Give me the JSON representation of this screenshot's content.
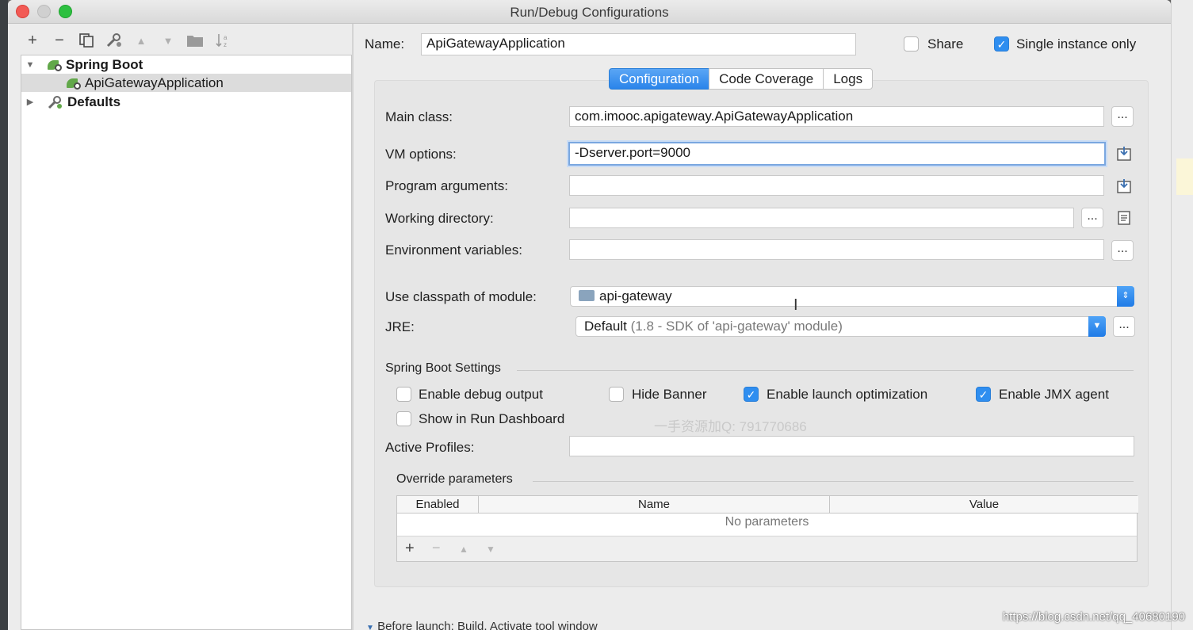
{
  "window": {
    "title": "Run/Debug Configurations"
  },
  "tree": {
    "group_label": "Spring Boot",
    "selected_item": "ApiGatewayApplication",
    "defaults_label": "Defaults"
  },
  "header": {
    "name_label": "Name:",
    "name_value": "ApiGatewayApplication",
    "share_label": "Share",
    "share_checked": false,
    "single_instance_label": "Single instance only",
    "single_instance_checked": true
  },
  "tabs": [
    {
      "label": "Configuration",
      "active": true
    },
    {
      "label": "Code Coverage",
      "active": false
    },
    {
      "label": "Logs",
      "active": false
    }
  ],
  "form": {
    "main_class_label": "Main class:",
    "main_class_value": "com.imooc.apigateway.ApiGatewayApplication",
    "vm_options_label": "VM options:",
    "vm_options_value": "-Dserver.port=9000",
    "program_args_label": "Program arguments:",
    "program_args_value": "",
    "working_dir_label": "Working directory:",
    "working_dir_value": "",
    "env_vars_label": "Environment variables:",
    "env_vars_value": "",
    "classpath_label": "Use classpath of module:",
    "classpath_value": "api-gateway",
    "jre_label": "JRE:",
    "jre_value": "Default",
    "jre_detail": "(1.8 - SDK of 'api-gateway' module)",
    "dots": "..."
  },
  "spring_boot_settings": {
    "title": "Spring Boot Settings",
    "debug_output": {
      "label": "Enable debug output",
      "checked": false
    },
    "hide_banner": {
      "label": "Hide Banner",
      "checked": false
    },
    "launch_optimization": {
      "label": "Enable launch optimization",
      "checked": true
    },
    "jmx_agent": {
      "label": "Enable JMX agent",
      "checked": true
    },
    "run_dashboard": {
      "label": "Show in Run Dashboard",
      "checked": false
    },
    "active_profiles_label": "Active Profiles:",
    "active_profiles_value": ""
  },
  "override": {
    "title": "Override parameters",
    "columns": [
      "Enabled",
      "Name",
      "Value"
    ],
    "empty_text": "No parameters"
  },
  "before_launch": "Before launch: Build, Activate tool window",
  "overlay": {
    "watermark": "一手资源加Q: 791770686",
    "csdn": "https://blog.csdn.net/qq_40680190"
  },
  "colors": {
    "accent": "#2f8ef0",
    "leaf_green": "#62a84a",
    "close_red": "#f25a55",
    "max_green": "#2dc040"
  }
}
